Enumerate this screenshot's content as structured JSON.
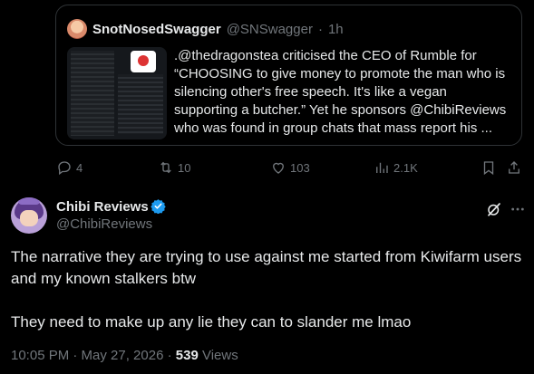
{
  "quoted_tweet": {
    "display_name": "SnotNosedSwagger",
    "handle": "@SNSwagger",
    "separator": "·",
    "time": "1h",
    "text": ".@thedragonstea criticised the CEO of Rumble for “CHOOSING to give money to promote the man who is silencing other's free speech. It's like a vegan supporting a butcher.” Yet he sponsors @ChibiReviews who was found in group chats that mass report his ..."
  },
  "actions": {
    "replies": "4",
    "retweets": "10",
    "likes": "103",
    "views": "2.1K"
  },
  "tweet": {
    "display_name": "Chibi Reviews",
    "handle": "@ChibiReviews",
    "paragraph_1": "The narrative they are trying to use against me started from Kiwifarm users and my known stalkers btw",
    "paragraph_2": "They need to make up any lie they can to slander me lmao",
    "timestamp": "10:05 PM · May 27, 2026 · ",
    "view_count": "539",
    "views_label": " Views"
  },
  "colors": {
    "background": "#000000",
    "text": "#e7e9ea",
    "muted": "#71767b",
    "verified": "#1d9bf0",
    "border": "#2f3336"
  },
  "icons": [
    "reply-icon",
    "retweet-icon",
    "like-icon",
    "analytics-icon",
    "bookmark-icon",
    "share-icon",
    "verified-badge-icon",
    "grok-icon",
    "more-icon"
  ]
}
